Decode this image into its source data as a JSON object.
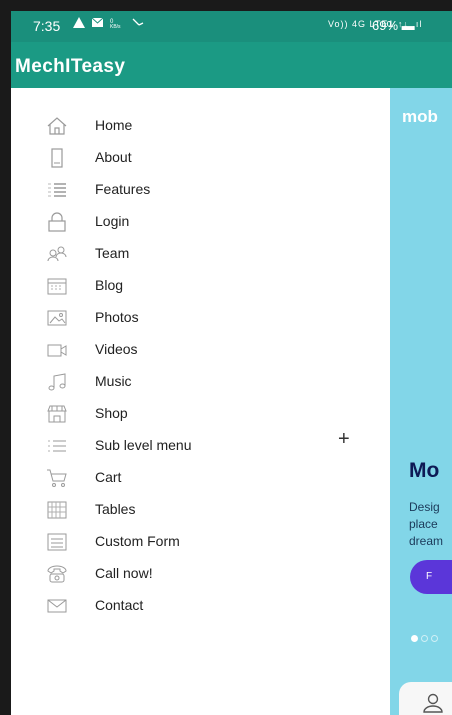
{
  "status": {
    "time": "7:35",
    "network": "Vo)) 4G LTE1 ↑↓ .ıl",
    "battery": "69%"
  },
  "app": {
    "title": "MechITeasy"
  },
  "menu": [
    {
      "label": "Home",
      "icon": "home-icon"
    },
    {
      "label": "About",
      "icon": "phone-icon"
    },
    {
      "label": "Features",
      "icon": "list-icon"
    },
    {
      "label": "Login",
      "icon": "lock-icon"
    },
    {
      "label": "Team",
      "icon": "team-icon"
    },
    {
      "label": "Blog",
      "icon": "calendar-icon"
    },
    {
      "label": "Photos",
      "icon": "photo-icon"
    },
    {
      "label": "Videos",
      "icon": "video-icon"
    },
    {
      "label": "Music",
      "icon": "music-icon"
    },
    {
      "label": "Shop",
      "icon": "shop-icon"
    },
    {
      "label": "Sub level menu",
      "icon": "menu-icon",
      "expand": "+"
    },
    {
      "label": "Cart",
      "icon": "cart-icon"
    },
    {
      "label": "Tables",
      "icon": "table-icon"
    },
    {
      "label": "Custom Form",
      "icon": "form-icon"
    },
    {
      "label": "Call now!",
      "icon": "call-icon"
    },
    {
      "label": "Contact",
      "icon": "mail-icon"
    }
  ],
  "content": {
    "brand": "mob",
    "heading": "Mo",
    "desc_lines": [
      "Desig",
      "place",
      "dream"
    ],
    "button_label": "F"
  },
  "colors": {
    "statusbar": "#1a8f7c",
    "appbar": "#1b9a84",
    "content_bg": "#82d6e8",
    "button": "#5b36d9"
  }
}
